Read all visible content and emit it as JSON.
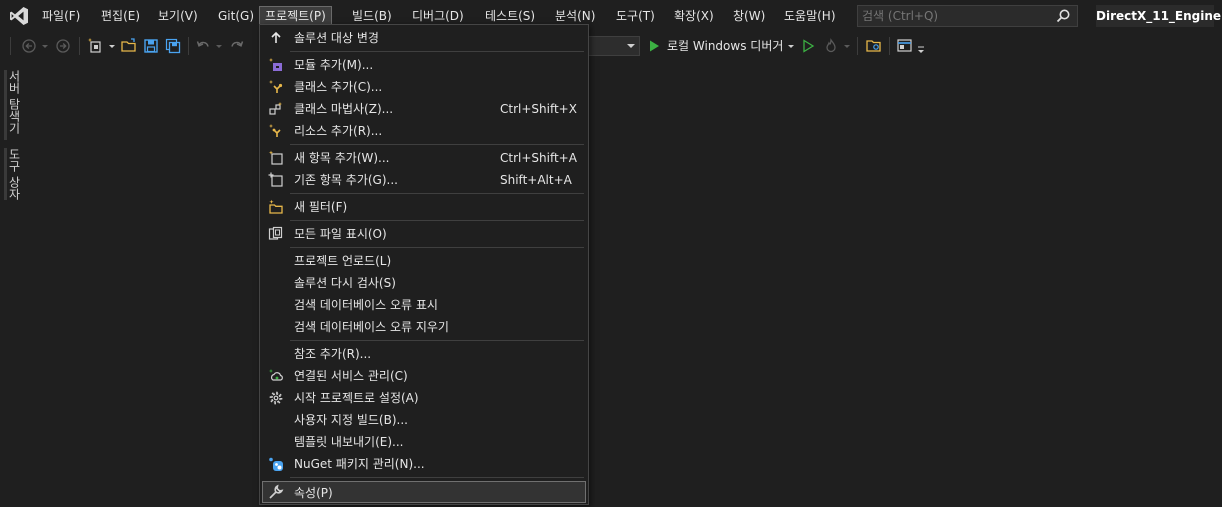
{
  "menubar": {
    "items": [
      {
        "label": "파일(F)"
      },
      {
        "label": "편집(E)"
      },
      {
        "label": "보기(V)"
      },
      {
        "label": "Git(G)"
      },
      {
        "label": "프로젝트(P)"
      },
      {
        "label": "빌드(B)"
      },
      {
        "label": "디버그(D)"
      },
      {
        "label": "테스트(S)"
      },
      {
        "label": "분석(N)"
      },
      {
        "label": "도구(T)"
      },
      {
        "label": "확장(X)"
      },
      {
        "label": "창(W)"
      },
      {
        "label": "도움말(H)"
      }
    ],
    "active_item": "프로젝트(P)",
    "search": {
      "placeholder": "검색 (Ctrl+Q)"
    },
    "solution_name": "DirectX_11_Engine"
  },
  "toolbar": {
    "debugger_label": "로컬 Windows 디버거",
    "colors": {
      "play": "#3cb043",
      "save": "#4aa3f0",
      "folder": "#e8b84a"
    }
  },
  "left_tabs": [
    {
      "label": "서버 탐색기"
    },
    {
      "label": "도구 상자"
    }
  ],
  "project_menu": {
    "items": [
      {
        "label": "솔루션 대상 변경",
        "shortcut": "",
        "icon": "arrow-up-icon"
      },
      {
        "label": "모듈 추가(M)...",
        "shortcut": "",
        "icon": "add-module-icon"
      },
      {
        "label": "클래스 추가(C)...",
        "shortcut": "",
        "icon": "add-class-icon"
      },
      {
        "label": "클래스 마법사(Z)...",
        "shortcut": "Ctrl+Shift+X",
        "icon": "class-wizard-icon"
      },
      {
        "label": "리소스 추가(R)...",
        "shortcut": "",
        "icon": "add-resource-icon"
      },
      {
        "label": "새 항목 추가(W)...",
        "shortcut": "Ctrl+Shift+A",
        "icon": "new-item-icon"
      },
      {
        "label": "기존 항목 추가(G)...",
        "shortcut": "Shift+Alt+A",
        "icon": "existing-item-icon"
      },
      {
        "label": "새 필터(F)",
        "shortcut": "",
        "icon": "new-filter-icon"
      },
      {
        "label": "모든 파일 표시(O)",
        "shortcut": "",
        "icon": "show-all-files-icon"
      },
      {
        "label": "프로젝트 언로드(L)",
        "shortcut": "",
        "icon": ""
      },
      {
        "label": "솔루션 다시 검사(S)",
        "shortcut": "",
        "icon": ""
      },
      {
        "label": "검색 데이터베이스 오류 표시",
        "shortcut": "",
        "icon": ""
      },
      {
        "label": "검색 데이터베이스 오류 지우기",
        "shortcut": "",
        "icon": ""
      },
      {
        "label": "참조 추가(R)...",
        "shortcut": "",
        "icon": ""
      },
      {
        "label": "연결된 서비스 관리(C)",
        "shortcut": "",
        "icon": "connected-service-icon"
      },
      {
        "label": "시작 프로젝트로 설정(A)",
        "shortcut": "",
        "icon": "gear-icon"
      },
      {
        "label": "사용자 지정 빌드(B)...",
        "shortcut": "",
        "icon": ""
      },
      {
        "label": "템플릿 내보내기(E)...",
        "shortcut": "",
        "icon": ""
      },
      {
        "label": "NuGet 패키지 관리(N)...",
        "shortcut": "",
        "icon": "nuget-icon"
      },
      {
        "label": "속성(P)",
        "shortcut": "",
        "icon": "wrench-icon"
      }
    ],
    "highlighted": "속성(P)"
  }
}
